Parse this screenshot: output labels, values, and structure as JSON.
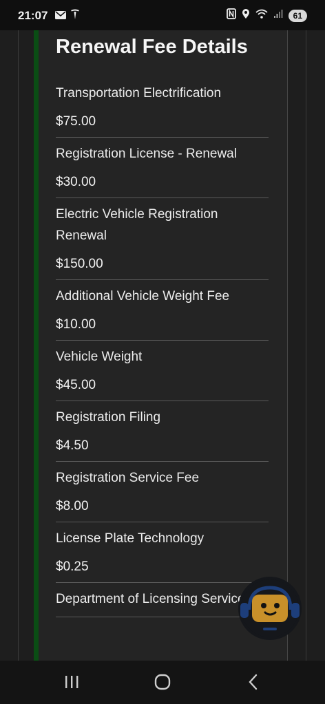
{
  "status_bar": {
    "time": "21:07",
    "battery": "61",
    "icons": [
      "mail-icon",
      "tesla-icon",
      "nfc-icon",
      "location-icon",
      "wifi-icon",
      "signal-icon"
    ]
  },
  "page": {
    "title": "Renewal Fee Details",
    "accent_color": "#0a4d14",
    "fees": [
      {
        "label": "Transportation Electrification",
        "amount": "$75.00"
      },
      {
        "label": "Registration License - Renewal",
        "amount": "$30.00"
      },
      {
        "label": "Electric Vehicle Registration Renewal",
        "amount": "$150.00"
      },
      {
        "label": "Additional Vehicle Weight Fee",
        "amount": "$10.00"
      },
      {
        "label": "Vehicle Weight",
        "amount": "$45.00"
      },
      {
        "label": "Registration Filing",
        "amount": "$4.50"
      },
      {
        "label": "Registration Service Fee",
        "amount": "$8.00"
      },
      {
        "label": "License Plate Technology",
        "amount": "$0.25"
      },
      {
        "label": "Department of Licensing Service",
        "amount": ""
      }
    ]
  },
  "assistant": {
    "icon": "robot-assistant-icon",
    "accent_color": "#c8902a"
  },
  "nav_bar": {
    "icons": [
      "recents-icon",
      "home-icon",
      "back-icon"
    ]
  }
}
